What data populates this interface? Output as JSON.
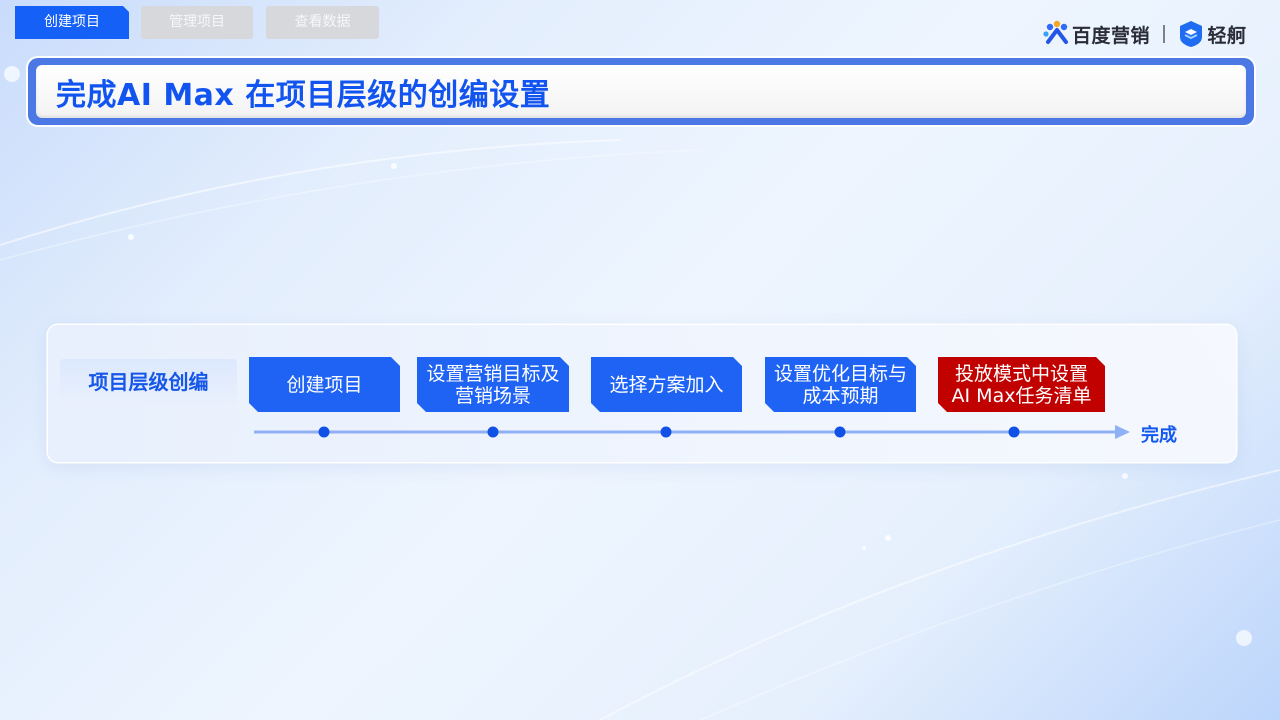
{
  "tabs": [
    {
      "label": "创建项目",
      "active": true
    },
    {
      "label": "管理项目",
      "active": false
    },
    {
      "label": "查看数据",
      "active": false
    }
  ],
  "logos": {
    "baidu_text": "百度营销",
    "qingge_text": "轻舸",
    "baidu_icon": "baidu-paw-icon",
    "qingge_icon": "qingge-shield-icon"
  },
  "title": "完成AI Max 在项目层级的创编设置",
  "process": {
    "row_label": "项目层级创编",
    "steps": [
      {
        "line1": "创建项目",
        "line2": ""
      },
      {
        "line1": "设置营销目标及",
        "line2": "营销场景"
      },
      {
        "line1": "选择方案加入",
        "line2": ""
      },
      {
        "line1": "设置优化目标与",
        "line2": "成本预期"
      },
      {
        "line1": "投放模式中设置",
        "line2": "AI Max任务清单"
      }
    ],
    "end_label": "完成"
  },
  "colors": {
    "accent_blue": "#1e63f3",
    "title_blue": "#1254ef",
    "highlight_red": "#c10000",
    "timeline_line": "#8fb0f5",
    "timeline_dot": "#1251e6"
  }
}
